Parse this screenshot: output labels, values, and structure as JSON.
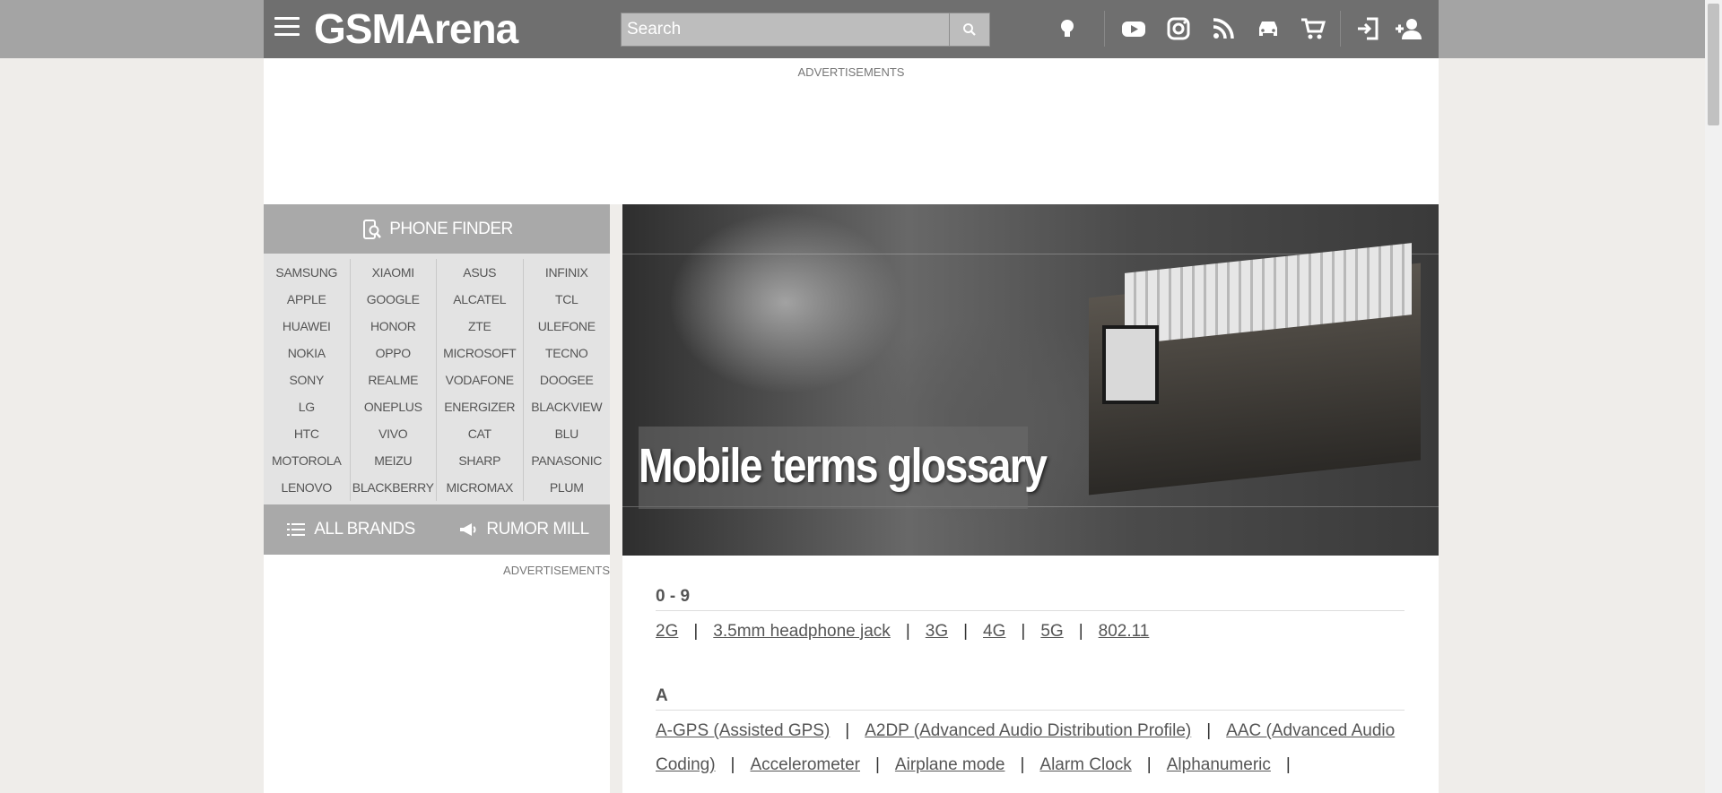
{
  "header": {
    "logo": "GSMArena",
    "search_placeholder": "Search"
  },
  "ads": {
    "top_label": "ADVERTISEMENTS",
    "side_label": "ADVERTISEMENTS"
  },
  "sidebar": {
    "phone_finder": "PHONE FINDER",
    "brands": [
      [
        "SAMSUNG",
        "APPLE",
        "HUAWEI",
        "NOKIA",
        "SONY",
        "LG",
        "HTC",
        "MOTOROLA",
        "LENOVO"
      ],
      [
        "XIAOMI",
        "GOOGLE",
        "HONOR",
        "OPPO",
        "REALME",
        "ONEPLUS",
        "VIVO",
        "MEIZU",
        "BLACKBERRY"
      ],
      [
        "ASUS",
        "ALCATEL",
        "ZTE",
        "MICROSOFT",
        "VODAFONE",
        "ENERGIZER",
        "CAT",
        "SHARP",
        "MICROMAX"
      ],
      [
        "INFINIX",
        "TCL",
        "ULEFONE",
        "TECNO",
        "DOOGEE",
        "BLACKVIEW",
        "BLU",
        "PANASONIC",
        "PLUM"
      ]
    ],
    "all_brands": "ALL BRANDS",
    "rumor_mill": "RUMOR MILL"
  },
  "hero": {
    "title": "Mobile terms glossary"
  },
  "glossary": [
    {
      "heading": "0 - 9",
      "terms": [
        "2G",
        "3.5mm headphone jack",
        "3G",
        "4G",
        "5G",
        "802.11"
      ]
    },
    {
      "heading": "A",
      "terms": [
        "A-GPS (Assisted GPS)",
        "A2DP (Advanced Audio Distribution Profile)",
        "AAC (Advanced Audio Coding)",
        "Accelerometer",
        "Airplane mode",
        "Alarm Clock",
        "Alphanumeric"
      ]
    }
  ]
}
